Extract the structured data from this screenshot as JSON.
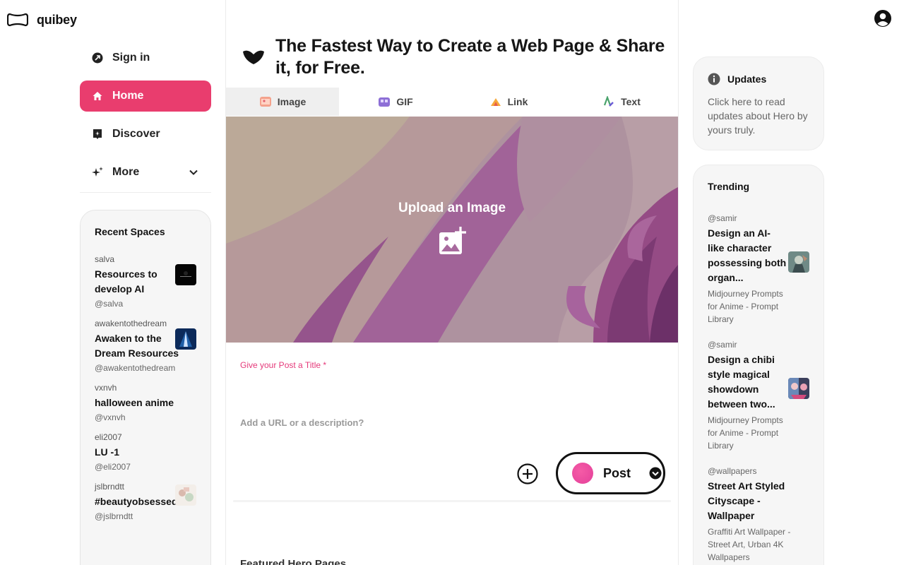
{
  "app": {
    "name": "quibey",
    "logo_icon": "quibey-logo-icon"
  },
  "header": {
    "account_icon": "account-circle-icon"
  },
  "nav": {
    "items": [
      {
        "label": "Sign in",
        "icon": "sign-in-icon"
      },
      {
        "label": "Home",
        "icon": "home-icon",
        "active": true
      },
      {
        "label": "Discover",
        "icon": "discover-icon"
      },
      {
        "label": "More",
        "icon": "sparkle-icon",
        "chevron": "chevron-down-icon"
      }
    ]
  },
  "recent_spaces": {
    "heading": "Recent Spaces",
    "items": [
      {
        "user": "salva",
        "title": "Resources to develop AI",
        "handle": "@salva"
      },
      {
        "user": "awakentothedream",
        "title": "Awaken to the Dream Resources",
        "handle": "@awakentothedream"
      },
      {
        "user": "vxnvh",
        "title": "halloween anime",
        "handle": "@vxnvh"
      },
      {
        "user": "eli2007",
        "title": "LU -1",
        "handle": "@eli2007"
      },
      {
        "user": "jslbrndtt",
        "title": "#beautyobsessed",
        "handle": "@jslbrndtt"
      }
    ]
  },
  "main": {
    "heading": "The Fastest Way to Create a Web Page & Share it, for Free.",
    "tabs": [
      {
        "label": "Image",
        "active": true
      },
      {
        "label": "GIF"
      },
      {
        "label": "Link"
      },
      {
        "label": "Text"
      }
    ],
    "upload_label": "Upload an Image",
    "title_field_label": "Give your Post a Title *",
    "title_value": "",
    "description_placeholder": "Add a URL or a description?",
    "post_label": "Post",
    "featured_heading": "Featured Hero Pages"
  },
  "updates": {
    "heading": "Updates",
    "text": "Click here to read updates about Hero by yours truly."
  },
  "trending": {
    "heading": "Trending",
    "items": [
      {
        "user": "@samir",
        "title": "Design an AI-like character possessing both organ...",
        "sub": "Midjourney Prompts for Anime - Prompt Library"
      },
      {
        "user": "@samir",
        "title": "Design a chibi style magical showdown between two...",
        "sub": "Midjourney Prompts for Anime - Prompt Library"
      },
      {
        "user": "@wallpapers",
        "title": "Street Art Styled Cityscape - Wallpaper",
        "sub": "Graffiti Art Wallpaper - Street Art, Urban 4K Wallpapers"
      }
    ]
  },
  "colors": {
    "accent": "#e93d6e",
    "post_dot": "#e4409a",
    "panel_bg": "#f6f6f6"
  }
}
